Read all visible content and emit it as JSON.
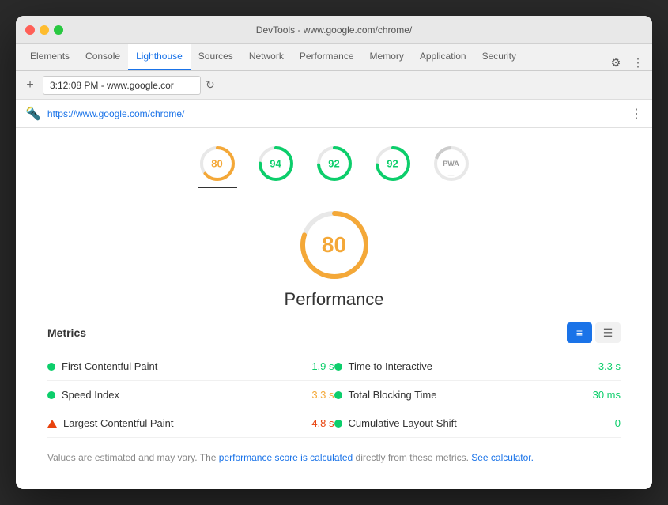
{
  "window": {
    "title": "DevTools - www.google.com/chrome/"
  },
  "tabs": {
    "items": [
      {
        "label": "Elements",
        "active": false
      },
      {
        "label": "Console",
        "active": false
      },
      {
        "label": "Lighthouse",
        "active": true
      },
      {
        "label": "Sources",
        "active": false
      },
      {
        "label": "Network",
        "active": false
      },
      {
        "label": "Performance",
        "active": false
      },
      {
        "label": "Memory",
        "active": false
      },
      {
        "label": "Application",
        "active": false
      },
      {
        "label": "Security",
        "active": false
      }
    ]
  },
  "address_bar": {
    "value": "3:12:08 PM - www.google.cor",
    "placeholder": "3:12:08 PM - www.google.cor"
  },
  "lighthouse_url": "https://www.google.com/chrome/",
  "score_circles": [
    {
      "value": 80,
      "color": "orange",
      "active": true
    },
    {
      "value": 94,
      "color": "green",
      "active": false
    },
    {
      "value": 92,
      "color": "green",
      "active": false
    },
    {
      "value": 92,
      "color": "green",
      "active": false
    },
    {
      "value": null,
      "color": "gray",
      "label": "PWA",
      "active": false
    }
  ],
  "performance": {
    "score": 80,
    "title": "Performance"
  },
  "metrics": {
    "title": "Metrics",
    "items_left": [
      {
        "name": "First Contentful Paint",
        "value": "1.9 s",
        "color": "green",
        "type": "dot"
      },
      {
        "name": "Speed Index",
        "value": "3.3 s",
        "color": "green",
        "type": "dot"
      },
      {
        "name": "Largest Contentful Paint",
        "value": "4.8 s",
        "color": "red",
        "type": "triangle"
      }
    ],
    "items_right": [
      {
        "name": "Time to Interactive",
        "value": "3.3 s",
        "color": "green",
        "type": "dot"
      },
      {
        "name": "Total Blocking Time",
        "value": "30 ms",
        "color": "green",
        "type": "dot"
      },
      {
        "name": "Cumulative Layout Shift",
        "value": "0",
        "color": "green",
        "type": "dot"
      }
    ]
  },
  "footer": {
    "text_before_link1": "Values are estimated and may vary. The ",
    "link1": "performance score is calculated",
    "text_between": " directly from these metrics. ",
    "link2": "See calculator.",
    "text_after": ""
  }
}
